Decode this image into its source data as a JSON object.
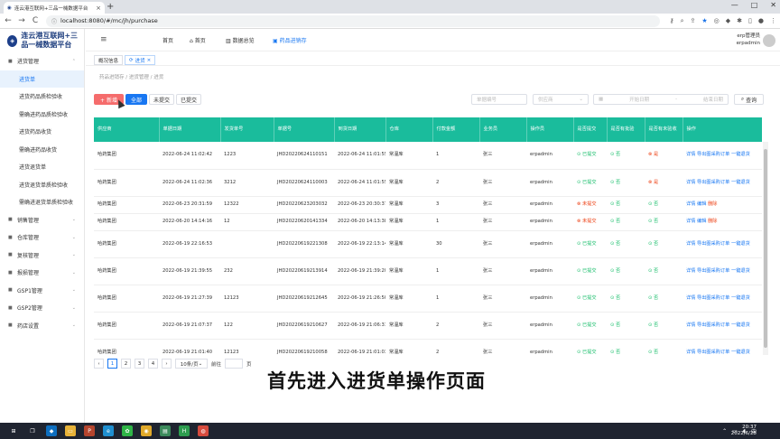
{
  "browser": {
    "tab_title": "连云港互联网+三品一械数据平台",
    "tab_close": "×",
    "new_tab": "+",
    "url": "localhost:8080/#/mc/jh/purchase",
    "back": "←",
    "forward": "→",
    "reload": "C",
    "min": "—",
    "max": "□",
    "close": "✕"
  },
  "app": {
    "logo_title": "连云港互联网+三品一械数据平台",
    "logo_mark": "◈"
  },
  "sidebar": {
    "items": [
      {
        "label": "进货管理",
        "type": "grp",
        "arrow": "⌃"
      },
      {
        "label": "进货单",
        "type": "sub",
        "active": true
      },
      {
        "label": "进货药品质检验收",
        "type": "sub"
      },
      {
        "label": "需确进药品质检验收",
        "type": "sub"
      },
      {
        "label": "进货药品收货",
        "type": "sub"
      },
      {
        "label": "需确进药品收货",
        "type": "sub"
      },
      {
        "label": "进货退货单",
        "type": "sub"
      },
      {
        "label": "进货退货单质检验收",
        "type": "sub"
      },
      {
        "label": "需确进退货单质检验收",
        "type": "sub"
      },
      {
        "label": "销售管理",
        "type": "grp",
        "arrow": "⌄"
      },
      {
        "label": "仓库管理",
        "type": "grp",
        "arrow": "⌄"
      },
      {
        "label": "复核管理",
        "type": "grp",
        "arrow": "⌄"
      },
      {
        "label": "报损管理",
        "type": "grp",
        "arrow": "⌄"
      },
      {
        "label": "GSP1管理",
        "type": "grp",
        "arrow": "⌄"
      },
      {
        "label": "GSP2管理",
        "type": "grp",
        "arrow": "⌄"
      },
      {
        "label": "药店设置",
        "type": "grp",
        "arrow": "⌄"
      }
    ]
  },
  "topnav": {
    "hamburger": "≡",
    "items": [
      "首页",
      "首页",
      "数据总览",
      "药品进销存"
    ],
    "user_role": "erp管理员",
    "user_name": "erpadmin"
  },
  "pagetabs": [
    {
      "label": "概况信息"
    },
    {
      "label": "进货",
      "close": "×"
    }
  ],
  "breadcrumb": "药品进销存 / 进货管理 / 进货",
  "actions": {
    "add": "+ 新增",
    "all": "全部",
    "not_submitted": "未提交",
    "submitted": "已提交"
  },
  "filters": {
    "doc_no": "单据编号",
    "warehouse": "供应商",
    "start_date": "开始日期",
    "date_sep": "-",
    "end_date": "结束日期",
    "query": "查询",
    "query_icon": "⌕"
  },
  "table": {
    "headers": [
      "供应商",
      "单据日期",
      "发货单号",
      "单据号",
      "到货日期",
      "仓库",
      "付款金额",
      "业务员",
      "操作员",
      "是否提交",
      "是否有批验",
      "是否有未验收",
      "操作"
    ],
    "rows": [
      {
        "supplier": "哈药集团",
        "date": "2022-06-24 11:02:42",
        "ship": "1223",
        "no": "JHD20220624110151",
        "arrive": "2022-06-24 11:01:55",
        "wh": "常温库",
        "amount": "1",
        "clerk": "张三",
        "op": "erpadmin",
        "submit": "已提交",
        "batch": "否",
        "unchecked": "是",
        "ops": [
          "详情",
          "导出图采购订单",
          "一键退货"
        ]
      },
      {
        "supplier": "哈药集团",
        "date": "2022-06-24 11:02:36",
        "ship": "3212",
        "no": "JHD20220624110003",
        "arrive": "2022-06-24 11:01:55",
        "wh": "常温库",
        "amount": "2",
        "clerk": "张三",
        "op": "erpadmin",
        "submit": "已提交",
        "batch": "否",
        "unchecked": "是",
        "ops": [
          "详情",
          "导出图采购订单",
          "一键退货"
        ]
      },
      {
        "supplier": "哈药集团",
        "date": "2022-06-23 20:31:59",
        "ship": "12322",
        "no": "JHD20220623203032",
        "arrive": "2022-06-23 20:30:37",
        "wh": "常温库",
        "amount": "3",
        "clerk": "张三",
        "op": "erpadmin",
        "submit": "未提交",
        "batch": "否",
        "unchecked": "否",
        "ops": [
          "详情",
          "编辑",
          "删除"
        ]
      },
      {
        "supplier": "哈药集团",
        "date": "2022-06-20 14:14:16",
        "ship": "12",
        "no": "JHD20220620141334",
        "arrive": "2022-06-20 14:13:38",
        "wh": "常温库",
        "amount": "1",
        "clerk": "张三",
        "op": "erpadmin",
        "submit": "未提交",
        "batch": "否",
        "unchecked": "否",
        "ops": [
          "详情",
          "编辑",
          "删除"
        ]
      },
      {
        "supplier": "哈药集团",
        "date": "2022-06-19 22:16:53",
        "ship": "",
        "no": "JHD20220619221308",
        "arrive": "2022-06-19 22:13:14",
        "wh": "常温库",
        "amount": "30",
        "clerk": "张三",
        "op": "erpadmin",
        "submit": "已提交",
        "batch": "否",
        "unchecked": "否",
        "ops": [
          "详情",
          "导出图采购订单",
          "一键退货"
        ]
      },
      {
        "supplier": "哈药集团",
        "date": "2022-06-19 21:39:55",
        "ship": "232",
        "no": "JHD20220619213914",
        "arrive": "2022-06-19 21:39:20",
        "wh": "常温库",
        "amount": "1",
        "clerk": "张三",
        "op": "erpadmin",
        "submit": "已提交",
        "batch": "否",
        "unchecked": "否",
        "ops": [
          "详情",
          "导出图采购订单",
          "一键退货"
        ]
      },
      {
        "supplier": "哈药集团",
        "date": "2022-06-19 21:27:39",
        "ship": "12123",
        "no": "JHD20220619212645",
        "arrive": "2022-06-19 21:26:50",
        "wh": "常温库",
        "amount": "1",
        "clerk": "张三",
        "op": "erpadmin",
        "submit": "已提交",
        "batch": "否",
        "unchecked": "否",
        "ops": [
          "详情",
          "导出图采购订单",
          "一键退货"
        ]
      },
      {
        "supplier": "哈药集团",
        "date": "2022-06-19 21:07:37",
        "ship": "122",
        "no": "JHD20220619210627",
        "arrive": "2022-06-19 21:06:31",
        "wh": "常温库",
        "amount": "2",
        "clerk": "张三",
        "op": "erpadmin",
        "submit": "已提交",
        "batch": "否",
        "unchecked": "否",
        "ops": [
          "详情",
          "导出图采购订单",
          "一键退货"
        ]
      },
      {
        "supplier": "哈药集团",
        "date": "2022-06-19 21:01:40",
        "ship": "12123",
        "no": "JHD20220619210058",
        "arrive": "2022-06-19 21:01:03",
        "wh": "常温库",
        "amount": "2",
        "clerk": "张三",
        "op": "erpadmin",
        "submit": "已提交",
        "batch": "否",
        "unchecked": "否",
        "ops": [
          "详情",
          "导出图采购订单",
          "一键退货"
        ]
      }
    ]
  },
  "pager": {
    "prev": "‹",
    "pages": [
      "1",
      "2",
      "3",
      "4"
    ],
    "next": "›",
    "page_size": "10条/页",
    "goto_label": "前往",
    "goto_unit": "页"
  },
  "caption": "首先进入进货单操作页面",
  "taskbar": {
    "time": "20:37",
    "date": "2022/6/25"
  },
  "colors": {
    "header": "#1abc9c",
    "primary": "#1877f2",
    "danger": "#f56c6c",
    "success": "#19be6b"
  }
}
